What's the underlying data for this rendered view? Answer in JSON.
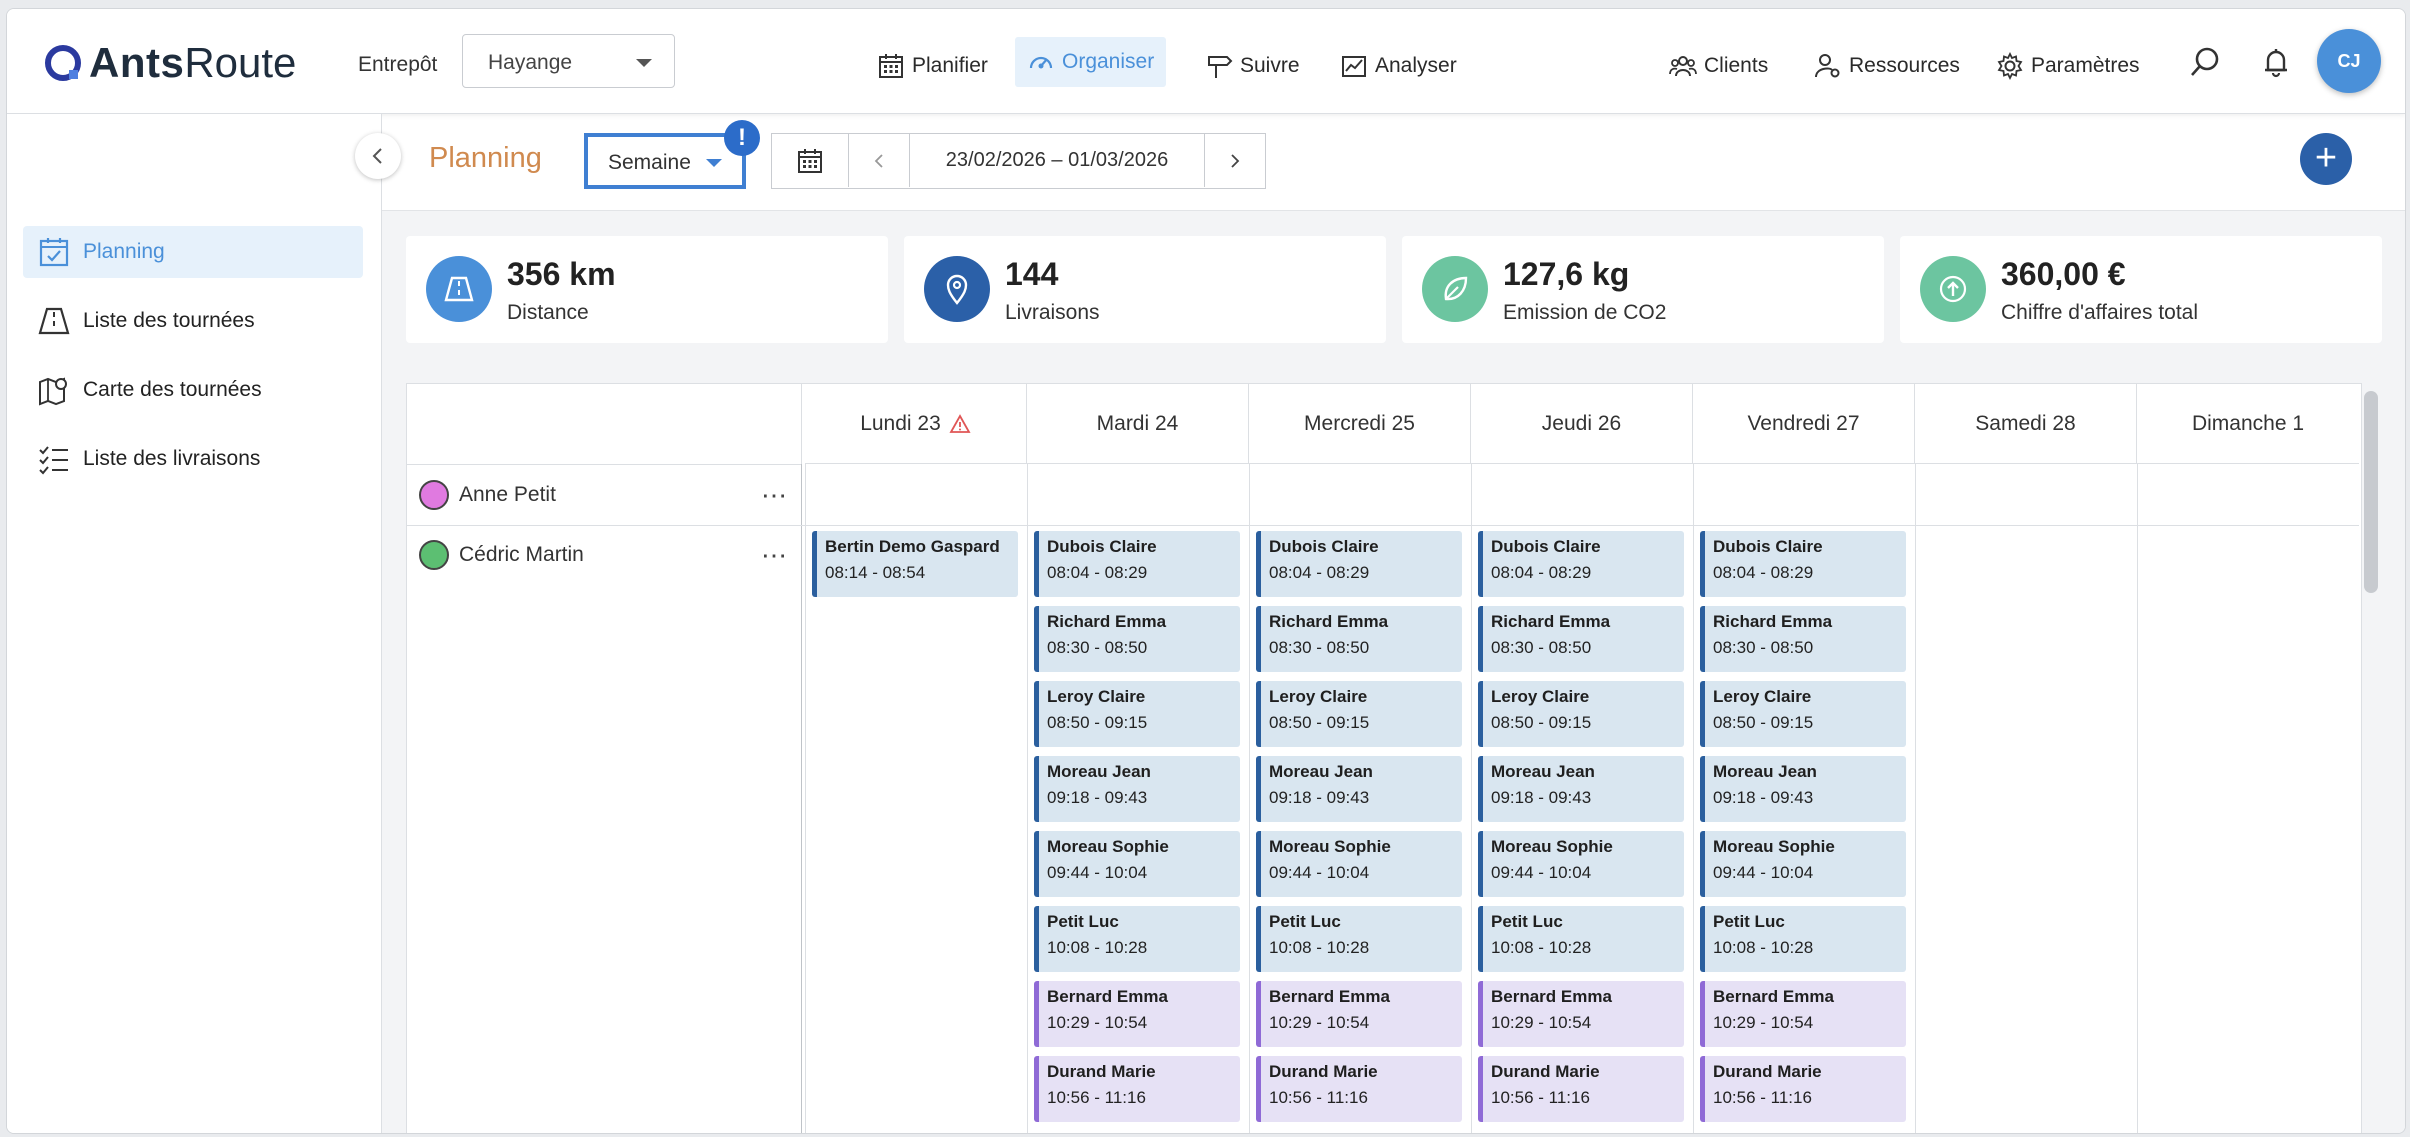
{
  "app": {
    "brand_bold": "Ants",
    "brand_light": "Route",
    "warehouse_label": "Entrepôt",
    "warehouse_value": "Hayange",
    "nav": [
      {
        "label": "Planifier",
        "icon": "calendar-icon"
      },
      {
        "label": "Organiser",
        "icon": "dashboard-icon"
      },
      {
        "label": "Suivre",
        "icon": "signpost-icon"
      },
      {
        "label": "Analyser",
        "icon": "chart-icon"
      }
    ],
    "right_nav": [
      {
        "label": "Clients",
        "icon": "users-icon"
      },
      {
        "label": "Ressources",
        "icon": "user-gear-icon"
      },
      {
        "label": "Paramètres",
        "icon": "gear-icon"
      }
    ],
    "avatar_initials": "CJ"
  },
  "sidebar": {
    "items": [
      {
        "label": "Planning",
        "icon": "calendar-check-icon",
        "active": true
      },
      {
        "label": "Liste des tournées",
        "icon": "road-icon"
      },
      {
        "label": "Carte des tournées",
        "icon": "map-icon"
      },
      {
        "label": "Liste des livraisons",
        "icon": "checklist-icon"
      }
    ]
  },
  "header": {
    "title": "Planning",
    "view": "Semaine",
    "badge": "!",
    "date_range": "23/02/2026 – 01/03/2026",
    "add": "+"
  },
  "stats": [
    {
      "value": "356 km",
      "label": "Distance",
      "color": "#4a90d9",
      "icon": "road-icon"
    },
    {
      "value": "144",
      "label": "Livraisons",
      "color": "#2b60a8",
      "icon": "pin-icon"
    },
    {
      "value": "127,6 kg",
      "label": "Emission de CO2",
      "color": "#6cc5a0",
      "icon": "leaf-icon"
    },
    {
      "value": "360,00 €",
      "label": "Chiffre d'affaires total",
      "color": "#6cc5a0",
      "icon": "arrow-up-icon"
    }
  ],
  "planning": {
    "days": [
      "Lundi 23",
      "Mardi 24",
      "Mercredi 25",
      "Jeudi 26",
      "Vendredi 27",
      "Samedi 28",
      "Dimanche 1"
    ],
    "resources": [
      {
        "name": "Anne Petit",
        "color": "#e07ae0"
      },
      {
        "name": "Cédric Martin",
        "color": "#5cbf72"
      }
    ],
    "monday_events": [
      {
        "name": "Bertin Demo Gaspard",
        "time": "08:14 - 08:54",
        "kind": "blue"
      }
    ],
    "weekday_events": [
      {
        "name": "Dubois Claire",
        "time": "08:04 - 08:29",
        "kind": "blue"
      },
      {
        "name": "Richard Emma",
        "time": "08:30 - 08:50",
        "kind": "blue"
      },
      {
        "name": "Leroy Claire",
        "time": "08:50 - 09:15",
        "kind": "blue"
      },
      {
        "name": "Moreau Jean",
        "time": "09:18 - 09:43",
        "kind": "blue"
      },
      {
        "name": "Moreau Sophie",
        "time": "09:44 - 10:04",
        "kind": "blue"
      },
      {
        "name": "Petit Luc",
        "time": "10:08 - 10:28",
        "kind": "blue"
      },
      {
        "name": "Bernard Emma",
        "time": "10:29 - 10:54",
        "kind": "purple"
      },
      {
        "name": "Durand Marie",
        "time": "10:56 - 11:16",
        "kind": "purple"
      }
    ]
  }
}
